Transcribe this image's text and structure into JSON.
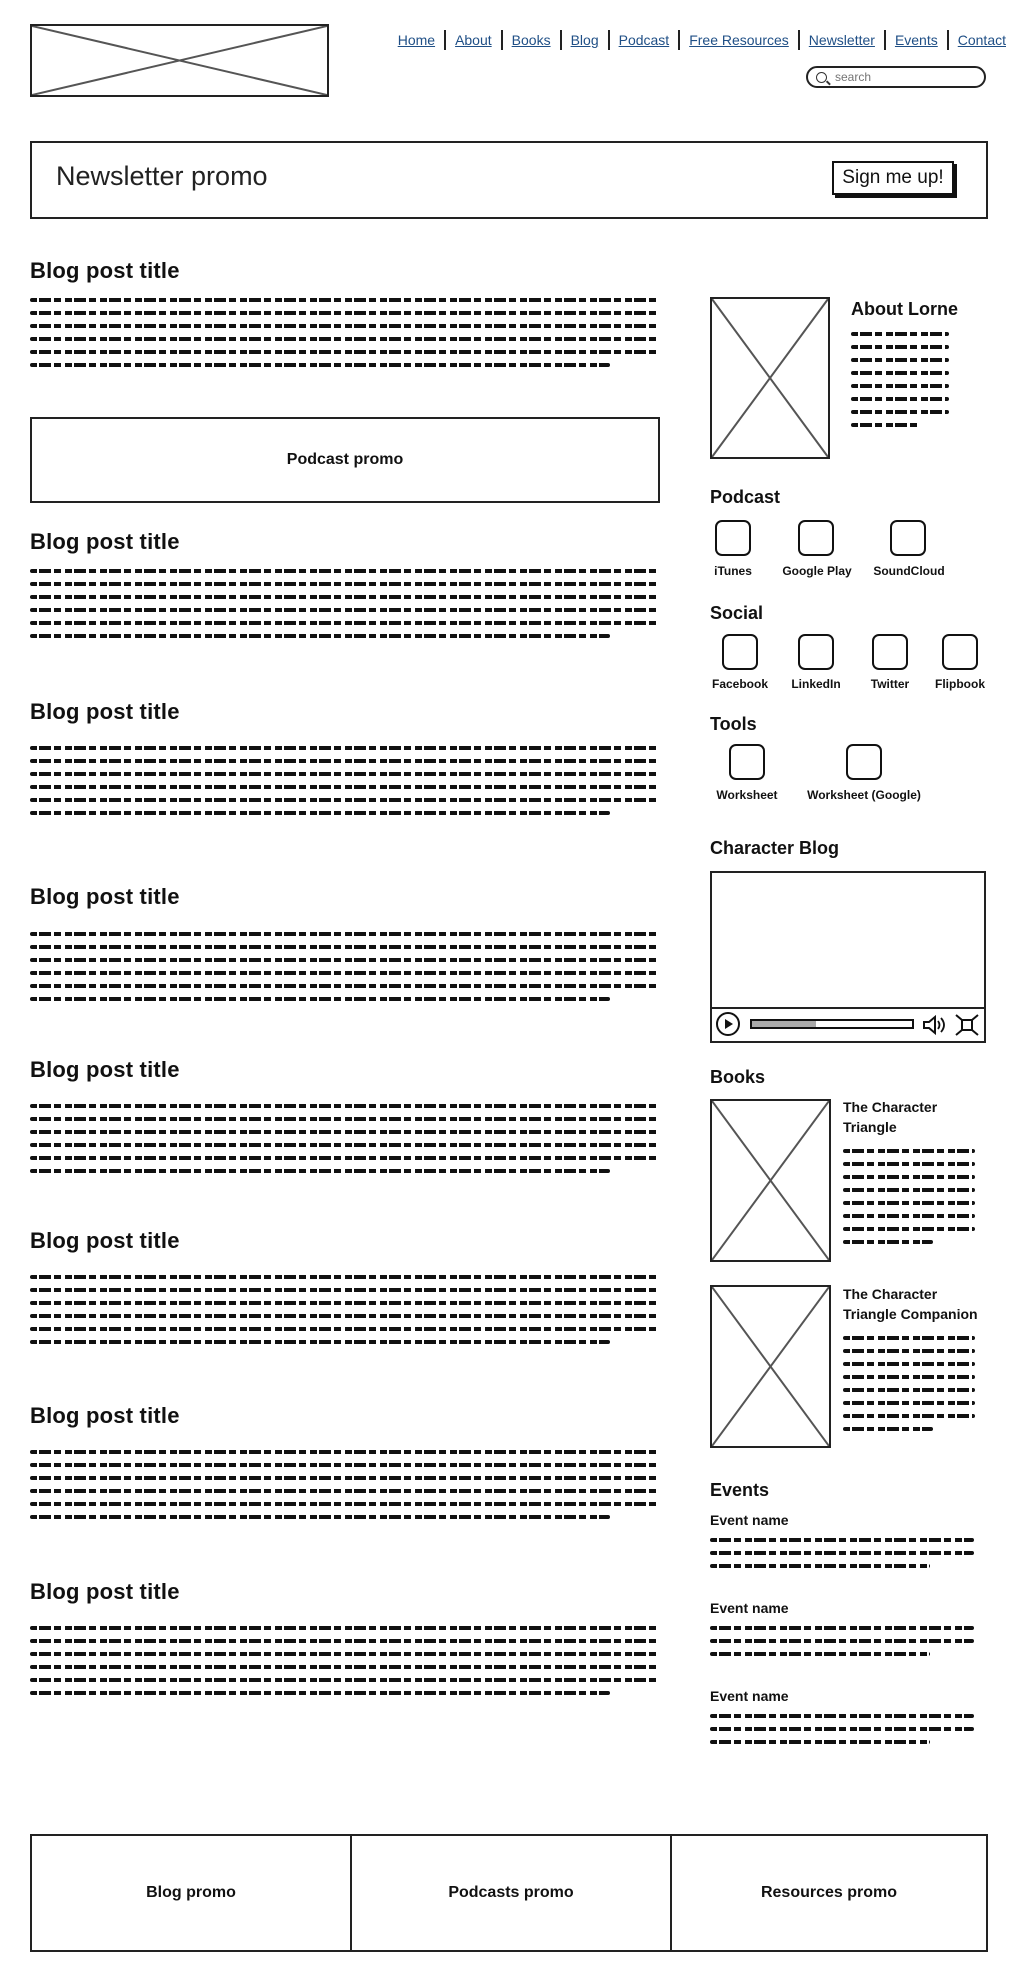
{
  "header": {
    "logo_icon": "image-placeholder-icon",
    "nav": [
      "Home",
      "About",
      "Books",
      "Blog",
      "Podcast",
      "Free Resources",
      "Newsletter",
      "Events",
      "Contact"
    ],
    "search_placeholder": "search"
  },
  "newsletter": {
    "title": "Newsletter promo",
    "button": "Sign me up!"
  },
  "main": {
    "posts": [
      {
        "title": "Blog post title"
      },
      {
        "title": "Blog post title"
      },
      {
        "title": "Blog post title"
      },
      {
        "title": "Blog post title"
      },
      {
        "title": "Blog post title"
      },
      {
        "title": "Blog post title"
      },
      {
        "title": "Blog post title"
      },
      {
        "title": "Blog post title"
      }
    ],
    "podcast_promo": "Podcast promo"
  },
  "sidebar": {
    "about_title": "About Lorne",
    "podcast_title": "Podcast",
    "podcast_links": [
      "iTunes",
      "Google Play",
      "SoundCloud"
    ],
    "social_title": "Social",
    "social_links": [
      "Facebook",
      "LinkedIn",
      "Twitter",
      "Flipbook"
    ],
    "tools_title": "Tools",
    "tools_links": [
      "Worksheet",
      "Worksheet (Google)"
    ],
    "character_blog_title": "Character Blog",
    "video": {
      "progress": 0.4,
      "icons": [
        "play-icon",
        "volume-icon",
        "fullscreen-icon"
      ]
    },
    "books_title": "Books",
    "books": [
      {
        "title": "The Character Triangle"
      },
      {
        "title": "The Character Triangle Companion"
      }
    ],
    "events_title": "Events",
    "events": [
      {
        "name": "Event name"
      },
      {
        "name": "Event name"
      },
      {
        "name": "Event name"
      }
    ]
  },
  "footer": {
    "promos": [
      "Blog promo",
      "Podcasts promo",
      "Resources promo"
    ]
  }
}
